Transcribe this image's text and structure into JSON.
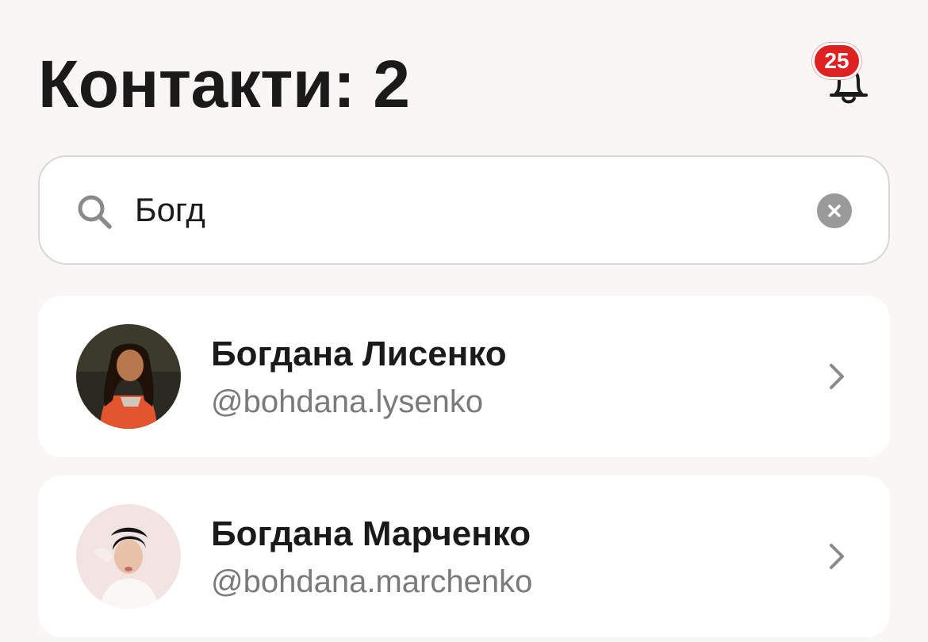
{
  "header": {
    "title": "Контакти: 2",
    "notifications": {
      "icon": "bell-icon",
      "count": "25",
      "badge_color": "#e02121"
    }
  },
  "search": {
    "icon": "search-icon",
    "value": "Богд",
    "clear_icon": "clear-icon"
  },
  "contacts": [
    {
      "name": "Богдана Лисенко",
      "handle": "@bohdana.lysenko",
      "avatar": "avatar-photo",
      "chevron": "chevron-right-icon"
    },
    {
      "name": "Богдана Марченко",
      "handle": "@bohdana.marchenko",
      "avatar": "avatar-photo",
      "chevron": "chevron-right-icon"
    }
  ],
  "colors": {
    "background": "#f8f7f5",
    "card": "#ffffff",
    "text_primary": "#1a1a1a",
    "text_secondary": "#7a7a7a",
    "accent_badge": "#e02121"
  }
}
